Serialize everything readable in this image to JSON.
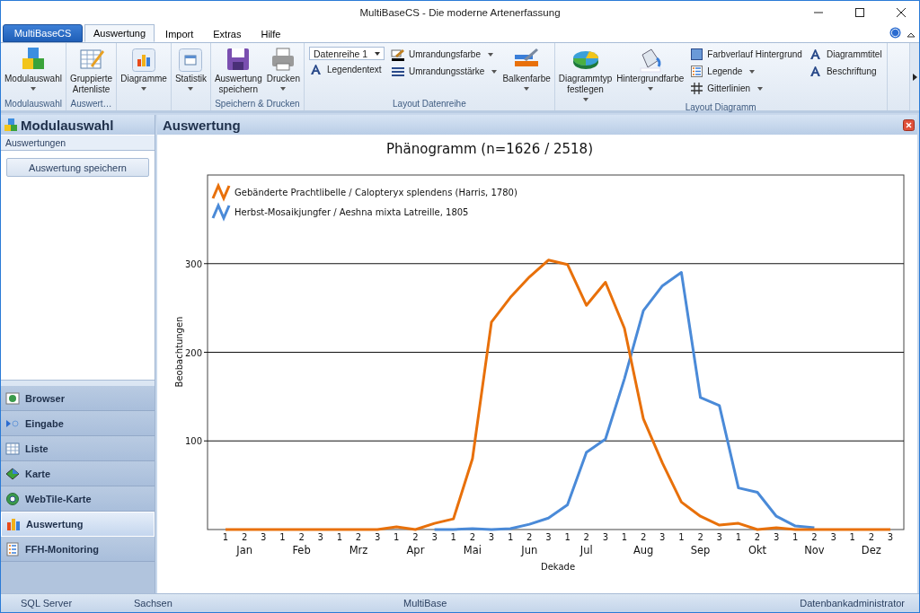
{
  "window": {
    "title": "MultiBaseCS - Die moderne Artenerfassung"
  },
  "app_button": "MultiBaseCS",
  "tabs": [
    {
      "label": "Auswertung",
      "selected": true
    },
    {
      "label": "Import",
      "selected": false
    },
    {
      "label": "Extras",
      "selected": false
    },
    {
      "label": "Hilfe",
      "selected": false
    }
  ],
  "ribbon_groups": [
    {
      "label": "Modulauswahl",
      "items": [
        {
          "kind": "large",
          "label": "Modulauswahl",
          "dropdown": true
        }
      ]
    },
    {
      "label": "Auswert…",
      "items": [
        {
          "kind": "large",
          "label": "Gruppierte Artenliste",
          "dropdown": false
        }
      ]
    },
    {
      "items": [
        {
          "kind": "large",
          "label": "Diagramme",
          "dropdown": true
        }
      ]
    },
    {
      "items": [
        {
          "kind": "large",
          "label": "Statistik",
          "dropdown": true
        }
      ]
    },
    {
      "label": "Speichern & Drucken",
      "items": [
        {
          "kind": "large",
          "label": "Auswertung speichern",
          "dropdown": false
        },
        {
          "kind": "large",
          "label": "Drucken",
          "dropdown": true
        }
      ]
    },
    {
      "label": "Layout Datenreihe",
      "items": [
        {
          "kind": "stack",
          "rows": [
            {
              "kind": "combo",
              "value": "Datenreihe 1"
            },
            {
              "kind": "small",
              "label": "Legendentext",
              "dropdown": false
            }
          ]
        },
        {
          "kind": "stack",
          "rows": [
            {
              "kind": "small",
              "label": "Umrandungsfarbe",
              "dropdown": true
            },
            {
              "kind": "small",
              "label": "Umrandungsstärke",
              "dropdown": true
            }
          ]
        },
        {
          "kind": "large",
          "label": "Balkenfarbe",
          "dropdown": true
        }
      ]
    },
    {
      "label": "Layout Diagramm",
      "items": [
        {
          "kind": "large",
          "label": "Diagrammtyp festlegen",
          "dropdown": true
        },
        {
          "kind": "large",
          "label": "Hintergrundfarbe",
          "dropdown": true
        },
        {
          "kind": "stack",
          "rows": [
            {
              "kind": "small",
              "label": "Farbverlauf Hintergrund",
              "dropdown": false
            },
            {
              "kind": "small",
              "label": "Legende",
              "dropdown": true
            },
            {
              "kind": "small",
              "label": "Gitterlinien",
              "dropdown": true
            }
          ]
        },
        {
          "kind": "stack",
          "rows": [
            {
              "kind": "small",
              "label": "Diagrammtitel",
              "dropdown": false
            },
            {
              "kind": "small",
              "label": "Beschriftung",
              "dropdown": false
            }
          ]
        }
      ]
    }
  ],
  "sidebar": {
    "title": "Modulauswahl",
    "section": "Auswertungen",
    "button": "Auswertung speichern",
    "items": [
      {
        "label": "Browser",
        "selected": false
      },
      {
        "label": "Eingabe",
        "selected": false
      },
      {
        "label": "Liste",
        "selected": false
      },
      {
        "label": "Karte",
        "selected": false
      },
      {
        "label": "WebTile-Karte",
        "selected": false
      },
      {
        "label": "Auswertung",
        "selected": true
      },
      {
        "label": "FFH-Monitoring",
        "selected": false
      }
    ]
  },
  "content": {
    "title": "Auswertung",
    "chart_data": {
      "type": "line",
      "title": "Phänogramm (n=1626 / 2518)",
      "xlabel": "Dekade",
      "ylabel": "Beobachtungen",
      "categories": [
        "1",
        "2",
        "3",
        "1",
        "2",
        "3",
        "1",
        "2",
        "3",
        "1",
        "2",
        "3",
        "1",
        "2",
        "3",
        "1",
        "2",
        "3",
        "1",
        "2",
        "3",
        "1",
        "2",
        "3",
        "1",
        "2",
        "3",
        "1",
        "2",
        "3",
        "1",
        "2",
        "3",
        "1",
        "2",
        "3"
      ],
      "annotations": [
        "Jan",
        "Feb",
        "Mrz",
        "Apr",
        "Mai",
        "Jun",
        "Jul",
        "Aug",
        "Sep",
        "Okt",
        "Nov",
        "Dez"
      ],
      "series": [
        {
          "name": "Gebänderte Prachtlibelle / Calopteryx splendens (Harris, 1780)",
          "color": "#e8700a",
          "values": [
            0,
            0,
            0,
            0,
            0,
            0,
            0,
            0,
            0,
            3,
            0,
            7,
            12,
            80,
            234,
            262,
            285,
            304,
            299,
            253,
            279,
            227,
            125,
            75,
            31,
            15,
            5,
            7,
            0,
            2,
            0,
            0,
            0,
            0,
            0,
            0
          ]
        },
        {
          "name": "Herbst-Mosaikjungfer / Aeshna mixta Latreille, 1805",
          "color": "#4a8ad8",
          "values": [
            null,
            null,
            null,
            null,
            null,
            null,
            null,
            null,
            null,
            null,
            null,
            0,
            0,
            1,
            0,
            1,
            6,
            13,
            28,
            87,
            102,
            170,
            247,
            275,
            290,
            149,
            140,
            47,
            42,
            15,
            4,
            2,
            null,
            null,
            null,
            null
          ]
        }
      ],
      "ylim": [
        0,
        400
      ],
      "yticks": [
        100,
        200,
        300
      ],
      "grid": true,
      "legend": "top-left"
    }
  },
  "status_bar": [
    "SQL Server",
    "Sachsen",
    "MultiBase",
    "Datenbankadministrator"
  ]
}
